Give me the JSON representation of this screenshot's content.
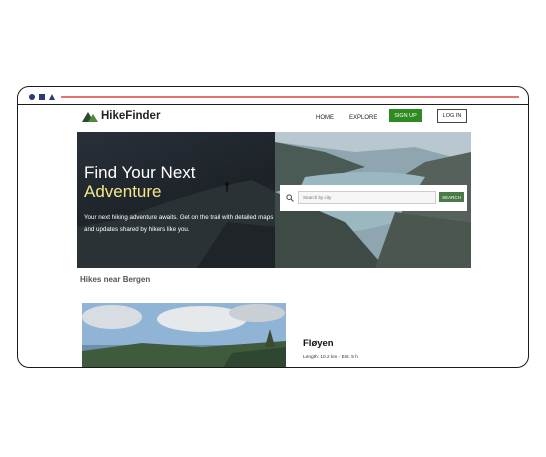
{
  "app": {
    "brand": "HikeFinder"
  },
  "nav": {
    "home": "HOME",
    "explore": "EXPLORE",
    "signup": "SIGN UP",
    "login": "LOG IN"
  },
  "hero": {
    "title_line1": "Find Your Next",
    "title_line2": "Adventure",
    "description": "Your next hiking adventure awaits. Get on the trail with detailed maps and updates shared by hikers like you."
  },
  "search": {
    "placeholder": "Search by city",
    "button": "SEARCH"
  },
  "section": {
    "title": "Hikes near Bergen"
  },
  "card": {
    "title": "Fløyen",
    "meta": "Length: 10.2 km - Est. 5 h"
  },
  "colors": {
    "accent_green": "#2e8b22",
    "hero_highlight": "#f3e98a",
    "browser_red": "#e57373"
  },
  "icons": {
    "logo": "mountain-logo-icon",
    "search": "search-icon"
  }
}
